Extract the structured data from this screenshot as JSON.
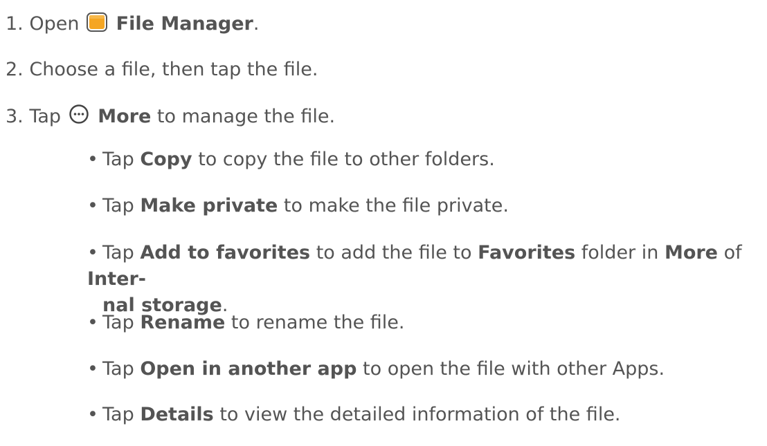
{
  "steps": [
    {
      "num": "1.",
      "pre": "Open",
      "bold": "File Manager",
      "post": "."
    },
    {
      "num": "2.",
      "text": "Choose a file, then tap the file."
    },
    {
      "num": "3.",
      "pre": "Tap",
      "bold": "More",
      "post": "to manage the file."
    }
  ],
  "bullets": {
    "copy": {
      "pre": "Tap",
      "bold": "Copy",
      "post": "to copy the file to other folders."
    },
    "private": {
      "pre": "Tap",
      "bold": "Make private",
      "post": "to make the file private."
    },
    "favorites": {
      "pre": "Tap",
      "bold": "Add to favorites",
      "mid1": "to add the file to",
      "bold2": "Favorites",
      "mid2": "folder in",
      "bold3": "More",
      "mid3": "of",
      "bold4a": "Inter-",
      "bold4b": "nal storage",
      "end": "."
    },
    "rename": {
      "pre": "Tap",
      "bold": "Rename",
      "post": "to rename the file."
    },
    "open": {
      "pre": "Tap",
      "bold": "Open in another app",
      "post": "to open the file with other Apps."
    },
    "details": {
      "pre": "Tap",
      "bold": "Details",
      "post": "to view the detailed information of the file."
    }
  },
  "icons": {
    "file_manager": "folder-icon",
    "more": "more-icon",
    "accent": "#f5a623"
  }
}
